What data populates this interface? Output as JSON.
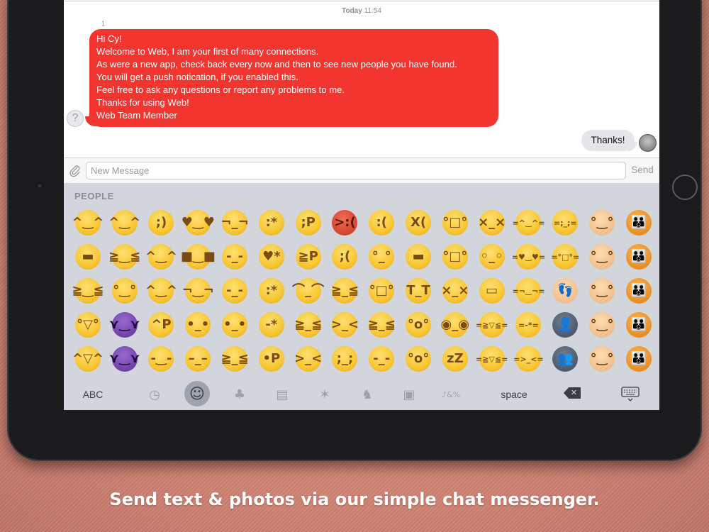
{
  "conversation": {
    "title": "1",
    "timestamp_day": "Today",
    "timestamp_time": "11:54",
    "sender_name": "1",
    "incoming_message": {
      "lines": [
        "Hi Cy!",
        "Welcome to Web, I am your first of many connections.",
        "As were a new app, check back every now and then to see new people you have found.",
        "You will get a push notication, if you enabled this.",
        "Feel free to ask any questions or report any problems to me.",
        "Thanks for using Web!",
        "Web Team Member"
      ],
      "color": "#f2362f"
    },
    "outgoing_message": "Thanks!",
    "unknown_avatar_glyph": "?"
  },
  "composer": {
    "placeholder": "New Message",
    "value": "",
    "send_label": "Send"
  },
  "keyboard": {
    "category_label": "PEOPLE",
    "abc_label": "ABC",
    "space_label": "space",
    "emoji_rows": [
      [
        "grinning-face",
        "grinning-sweat-face",
        "winking-face",
        "heart-eyes-face",
        "unamused-face",
        "kissing-face",
        "winking-tongue-face",
        "pouting-face",
        "frowning-face",
        "tired-face",
        "fearful-sweat-face",
        "dizzy-face",
        "smiling-cat",
        "crying-cat",
        "baby",
        "family"
      ],
      [
        "grimacing-face",
        "squinting-grin-face",
        "smiling-face",
        "sunglasses-face",
        "downcast-sweat-face",
        "kissing-heart-face",
        "squinting-tongue-face",
        "crying-face",
        "worried-face",
        "grimacing-face-2",
        "screaming-face",
        "blank-face",
        "heart-eyes-cat",
        "weary-cat",
        "boy",
        "family-2"
      ],
      [
        "tears-of-joy-face",
        "halo-face",
        "blushing-face",
        "smirking-face",
        "relieved-face",
        "kissing-smiling-eyes-face",
        "disappointed-face",
        "confounded-face",
        "cold-sweat-face",
        "loudly-crying-face",
        "astonished-face",
        "mask-face",
        "smirking-cat",
        "footprints",
        "girl",
        "family-3"
      ],
      [
        "big-grin-face",
        "imp-face",
        "savoring-face",
        "neutral-face",
        "confused-face",
        "kissing-closed-eyes-face",
        "persevering-face",
        "steam-face",
        "weary-face",
        "open-mouth-face",
        "flushed-face",
        "joy-cat",
        "kissing-cat",
        "bust-silhouette",
        "man",
        "family-4"
      ],
      [
        "grinning-smiling-eyes-face",
        "angry-imp-face",
        "pensive-smile-face",
        "expressionless-face",
        "confounded-face-2",
        "stuck-out-tongue-face",
        "angry-face",
        "disappointed-relieved-face",
        "sleepy-face",
        "hushed-face",
        "sleeping-face",
        "laughing-cat",
        "pouting-cat",
        "busts-silhouette",
        "woman",
        "family-5"
      ]
    ],
    "emoji_glyphs": [
      [
        "^‿^",
        "^‿^",
        ";)",
        "♥‿♥",
        "¬_¬",
        ":*",
        ";P",
        ">:(",
        ":(",
        "X(",
        "°□°",
        "×_×",
        "=^‿^=",
        "=;_;=",
        "°‿°",
        "👪"
      ],
      [
        "▬",
        "≧‿≦",
        "^‿^",
        "■‿■",
        "-_-",
        "♥*",
        "≧P",
        ";(",
        "°_°",
        "▬",
        "°□°",
        "◦_◦",
        "=♥‿♥=",
        "=°□°=",
        "°‿°",
        "👪"
      ],
      [
        "≧‿≦",
        "°‿°",
        "^‿^",
        "¬‿¬",
        "-_-",
        ":*",
        "⌒_⌒",
        "≧_≦",
        "°□°",
        "T_T",
        "×_×",
        "▭",
        "=¬‿¬=",
        "👣",
        "°‿°",
        "👪"
      ],
      [
        "°▽°",
        "⋎‿⋎",
        "^P",
        "•_•",
        "•_•",
        "-*",
        "≧_≦",
        ">_<",
        "≧_≦",
        "°o°",
        "◉_◉",
        "=≧▽≦=",
        "=-*=",
        "👤",
        "°‿°",
        "👪"
      ],
      [
        "^▽^",
        "⋎‿⋎",
        "-‿-",
        "–_–",
        "≧_≦",
        "•P",
        ">_<",
        ";_;",
        "-_-",
        "°o°",
        "zZ",
        "=≧▽≦=",
        "=>_<=",
        "👥",
        "°‿°",
        "👪"
      ]
    ],
    "emoji_colors": [
      [
        "",
        "",
        "",
        "",
        "",
        "",
        "",
        "red",
        "",
        "",
        "",
        "",
        "",
        "",
        "pale",
        "orange"
      ],
      [
        "",
        "",
        "",
        "",
        "",
        "",
        "",
        "",
        "",
        "",
        "",
        "",
        "",
        "",
        "pale",
        "orange"
      ],
      [
        "",
        "",
        "",
        "",
        "",
        "",
        "",
        "",
        "",
        "",
        "",
        "",
        "",
        "pale",
        "pale",
        "orange"
      ],
      [
        "",
        "purple",
        "",
        "",
        "",
        "",
        "",
        "",
        "",
        "",
        "",
        "",
        "",
        "gray",
        "pale",
        "orange"
      ],
      [
        "",
        "purple",
        "",
        "",
        "",
        "",
        "",
        "",
        "",
        "",
        "",
        "",
        "",
        "gray",
        "pale",
        "orange"
      ]
    ],
    "category_icons": [
      "recent-clock-icon",
      "people-smiley-icon",
      "nature-tree-icon",
      "objects-bell-icon",
      "celebration-icon",
      "activity-runner-icon",
      "travel-car-icon",
      "symbols-icon"
    ],
    "category_glyphs": [
      "◷",
      "☺",
      "♣",
      "▤",
      "✶",
      "♞",
      "▣",
      "♪&%"
    ]
  },
  "caption": "Send text & photos via our simple chat messenger."
}
